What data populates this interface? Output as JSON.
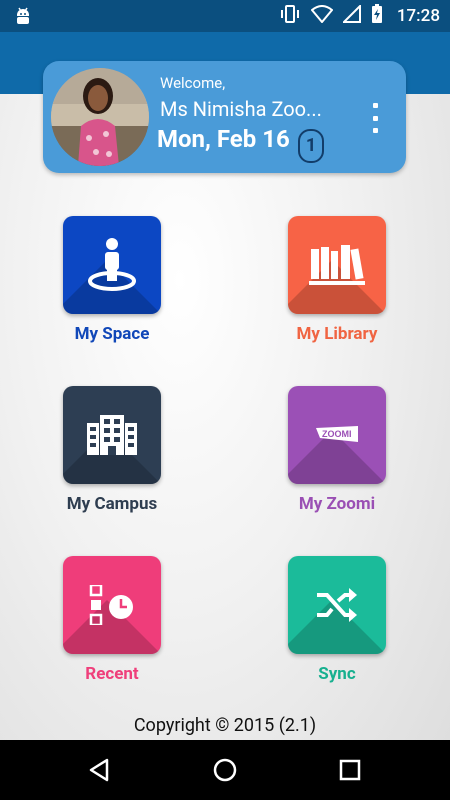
{
  "status_bar": {
    "time": "17:28",
    "icons": [
      "android-debug-icon",
      "vibrate-icon",
      "wifi-icon",
      "signal-icon",
      "battery-charging-icon"
    ]
  },
  "header": {
    "welcome": "Welcome,",
    "user_name": "Ms Nimisha Zoo...",
    "date": "Mon, Feb 16",
    "notification_count": "1",
    "card_color": "#4a9bd8"
  },
  "tiles": [
    {
      "label": "My Space",
      "icon": "person-location-icon",
      "color": "#0c47c3"
    },
    {
      "label": "My Library",
      "icon": "books-icon",
      "color": "#f76346"
    },
    {
      "label": "My Campus",
      "icon": "building-icon",
      "color": "#2d3e53"
    },
    {
      "label": "My Zoomi",
      "icon": "zoomi-logo-icon",
      "color": "#9b50b6"
    },
    {
      "label": "Recent",
      "icon": "recent-history-icon",
      "color": "#ef3d7a"
    },
    {
      "label": "Sync",
      "icon": "shuffle-sync-icon",
      "color": "#1bbb9a"
    }
  ],
  "footer": {
    "copyright": "Copyright © 2015 (2.1)"
  },
  "nav": {
    "icons": [
      "back-icon",
      "home-icon",
      "recents-icon"
    ]
  },
  "colors": {
    "app_bar": "#0f6aa9",
    "status_bar": "#0b4f7f"
  }
}
